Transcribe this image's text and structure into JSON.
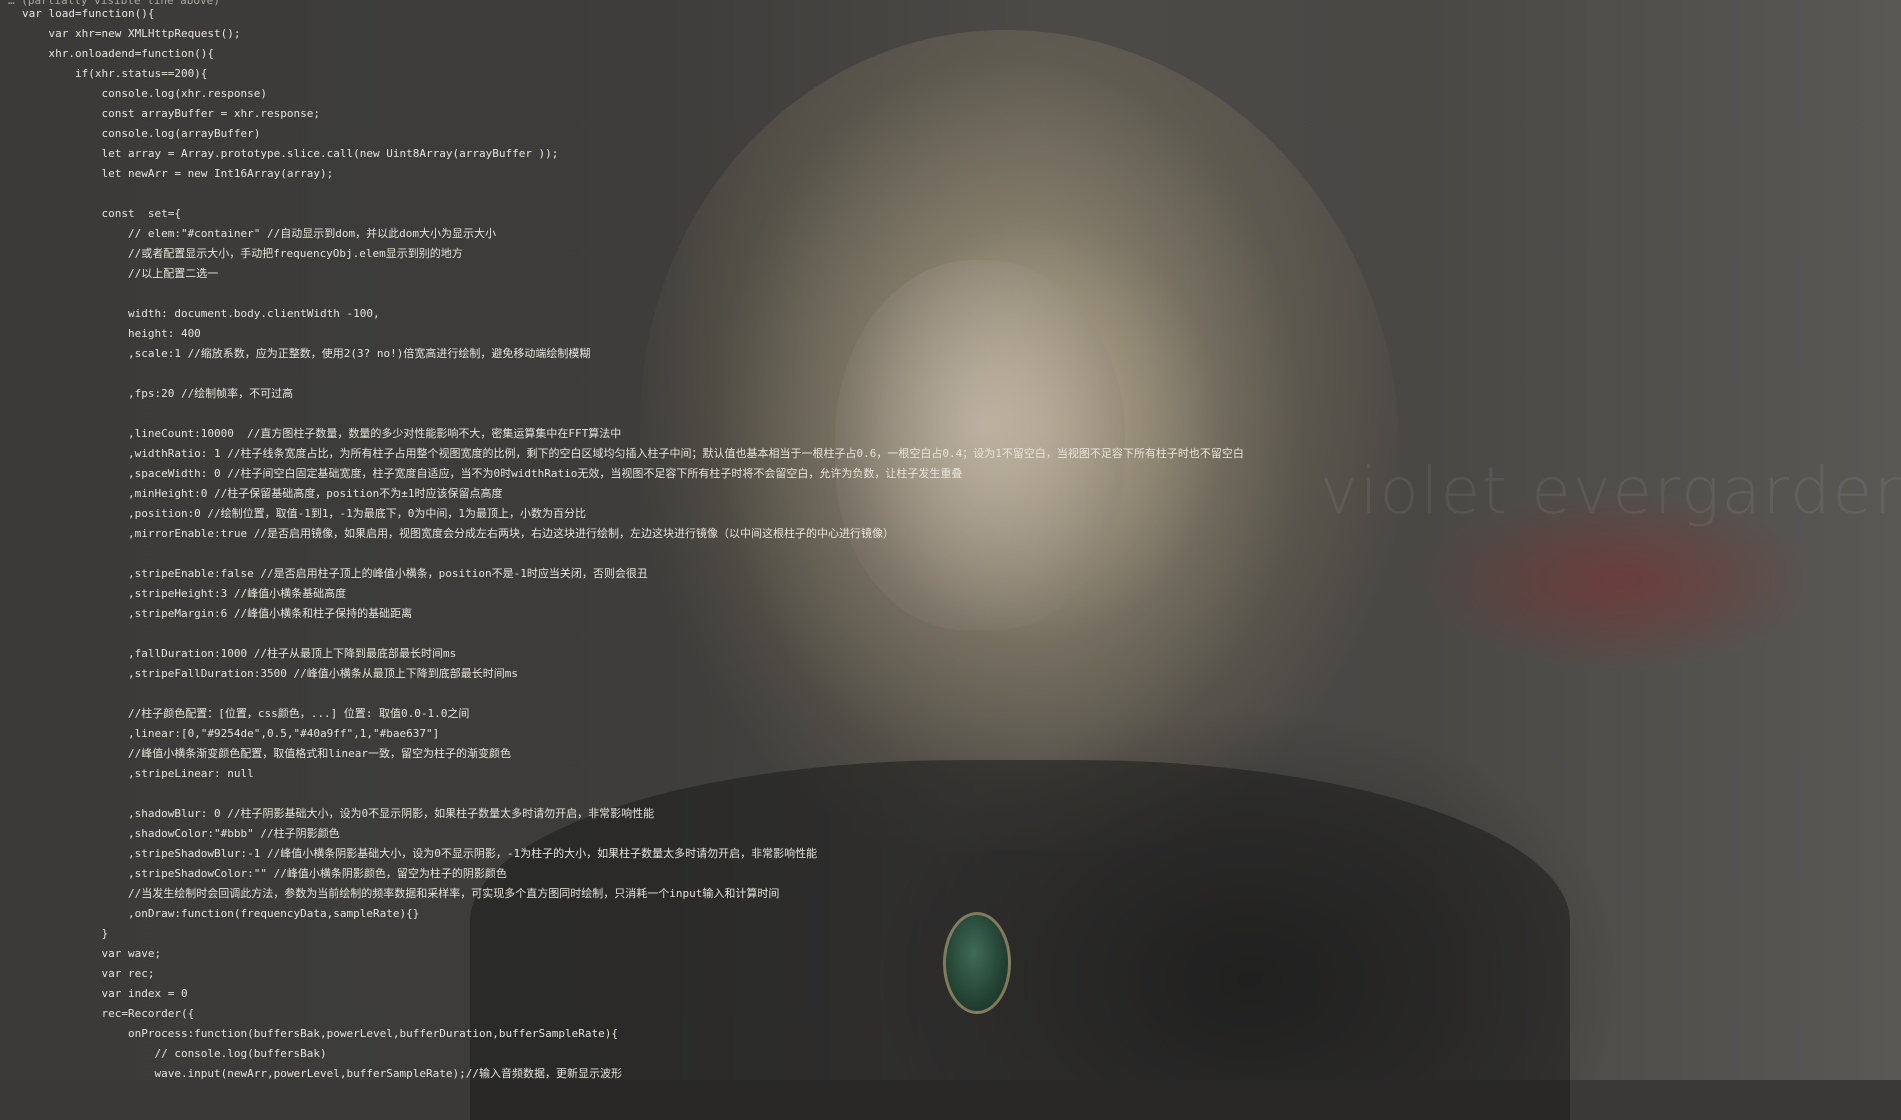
{
  "wallpaper": {
    "watermark_text": "violet evergarden"
  },
  "editor": {
    "top_truncated_line": "… (partially visible line above)",
    "lines": [
      "var load=function(){",
      "    var xhr=new XMLHttpRequest();",
      "    xhr.onloadend=function(){",
      "        if(xhr.status==200){",
      "            console.log(xhr.response)",
      "            const arrayBuffer = xhr.response;",
      "            console.log(arrayBuffer)",
      "            let array = Array.prototype.slice.call(new Uint8Array(arrayBuffer ));",
      "            let newArr = new Int16Array(array);",
      "",
      "            const  set={",
      "                // elem:\"#container\" //自动显示到dom，并以此dom大小为显示大小",
      "                //或者配置显示大小，手动把frequencyObj.elem显示到别的地方",
      "                //以上配置二选一",
      "",
      "                width: document.body.clientWidth -100,",
      "                height: 400",
      "                ,scale:1 //缩放系数，应为正整数，使用2(3? no!)倍宽高进行绘制，避免移动端绘制模糊",
      "",
      "                ,fps:20 //绘制帧率，不可过高",
      "",
      "                ,lineCount:10000  //直方图柱子数量，数量的多少对性能影响不大，密集运算集中在FFT算法中",
      "                ,widthRatio: 1 //柱子线条宽度占比，为所有柱子占用整个视图宽度的比例，剩下的空白区域均匀插入柱子中间；默认值也基本相当于一根柱子占0.6，一根空白占0.4；设为1不留空白，当视图不足容下所有柱子时也不留空白",
      "                ,spaceWidth: 0 //柱子间空白固定基础宽度，柱子宽度自适应，当不为0时widthRatio无效，当视图不足容下所有柱子时将不会留空白，允许为负数，让柱子发生重叠",
      "                ,minHeight:0 //柱子保留基础高度，position不为±1时应该保留点高度",
      "                ,position:0 //绘制位置，取值-1到1，-1为最底下，0为中间，1为最顶上，小数为百分比",
      "                ,mirrorEnable:true //是否启用镜像，如果启用，视图宽度会分成左右两块，右边这块进行绘制，左边这块进行镜像（以中间这根柱子的中心进行镜像）",
      "",
      "                ,stripeEnable:false //是否启用柱子顶上的峰值小横条，position不是-1时应当关闭，否则会很丑",
      "                ,stripeHeight:3 //峰值小横条基础高度",
      "                ,stripeMargin:6 //峰值小横条和柱子保持的基础距离",
      "",
      "                ,fallDuration:1000 //柱子从最顶上下降到最底部最长时间ms",
      "                ,stripeFallDuration:3500 //峰值小横条从最顶上下降到底部最长时间ms",
      "",
      "                //柱子颜色配置：[位置，css颜色，...] 位置: 取值0.0-1.0之间",
      "                ,linear:[0,\"#9254de\",0.5,\"#40a9ff\",1,\"#bae637\"]",
      "                //峰值小横条渐变颜色配置，取值格式和linear一致，留空为柱子的渐变颜色",
      "                ,stripeLinear: null",
      "",
      "                ,shadowBlur: 0 //柱子阴影基础大小，设为0不显示阴影，如果柱子数量太多时请勿开启，非常影响性能",
      "                ,shadowColor:\"#bbb\" //柱子阴影颜色",
      "                ,stripeShadowBlur:-1 //峰值小横条阴影基础大小，设为0不显示阴影，-1为柱子的大小，如果柱子数量太多时请勿开启，非常影响性能",
      "                ,stripeShadowColor:\"\" //峰值小横条阴影颜色，留空为柱子的阴影颜色",
      "                //当发生绘制时会回调此方法，参数为当前绘制的频率数据和采样率，可实现多个直方图同时绘制，只消耗一个input输入和计算时间",
      "                ,onDraw:function(frequencyData,sampleRate){}",
      "            }",
      "            var wave;",
      "            var rec;",
      "            var index = 0",
      "            rec=Recorder({",
      "                onProcess:function(buffersBak,powerLevel,bufferDuration,bufferSampleRate){",
      "                    // console.log(buffersBak)",
      "                    wave.input(newArr,powerLevel,bufferSampleRate);//输入音频数据，更新显示波形"
    ]
  },
  "colors": {
    "keyword": "#e0669b",
    "number": "#a68cff",
    "string": "#8fa9f0",
    "text": "#e8e4db"
  }
}
